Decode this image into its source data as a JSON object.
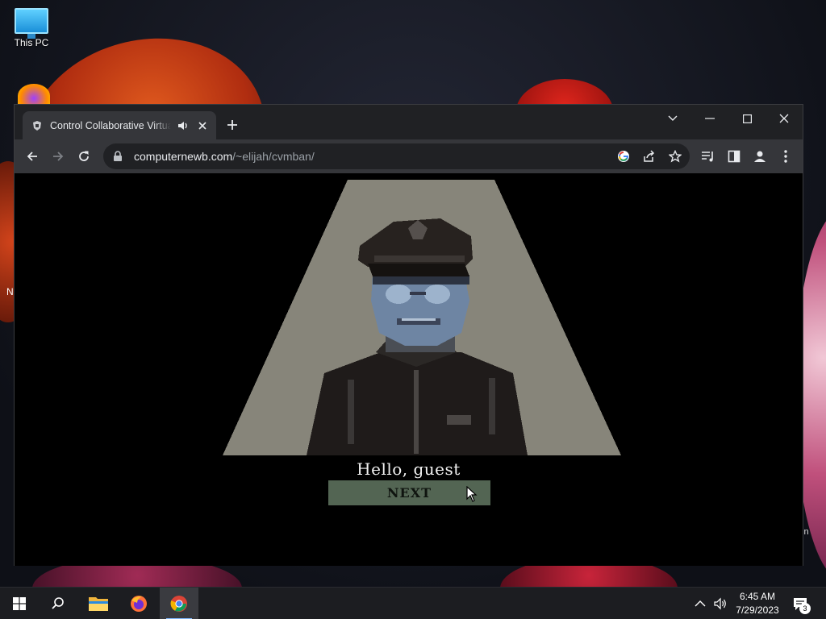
{
  "desktop": {
    "icons": [
      {
        "label": "This PC",
        "icon": "monitor-icon"
      }
    ],
    "partial_label_left": "N",
    "partial_label_right": "in"
  },
  "browser": {
    "tab": {
      "title": "Control Collaborative Virtual",
      "favicon": "cvm-favicon-icon",
      "audio_icon": "speaker-icon"
    },
    "url_host": "computernewb.com",
    "url_path": "/~elijah/cvmban/",
    "accent_color": "#35363a"
  },
  "game": {
    "dialog": "Hello, guest",
    "next_label": "NEXT",
    "spotlight_color": "#87857a",
    "button_color": "#536553"
  },
  "taskbar": {
    "time": "6:45 AM",
    "date": "7/29/2023",
    "notification_count": "3"
  }
}
